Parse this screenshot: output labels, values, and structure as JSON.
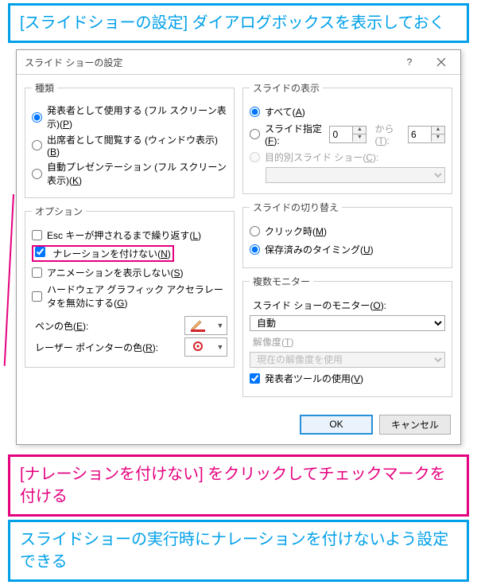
{
  "callouts": {
    "top": "[スライドショーの設定] ダイアログボックスを表示しておく",
    "click": "[ナレーションを付けない] をクリックしてチェックマークを付ける",
    "bottom": "スライドショーの実行時にナレーションを付けないよう設定できる"
  },
  "dialog": {
    "title": "スライド ショーの設定",
    "kind": {
      "legend": "種類",
      "presenter_pre": "発表者として使用する (フル スクリーン表示)(",
      "presenter_key": "P",
      "browse_pre": "出席者として閲覧する (ウィンドウ表示)(",
      "browse_key": "B",
      "kiosk_pre": "自動プレゼンテーション (フル スクリーン表示)(",
      "kiosk_key": "K",
      "close_paren": ")"
    },
    "options": {
      "legend": "オプション",
      "loop_pre": "Esc キーが押されるまで繰り返す(",
      "loop_key": "L",
      "no_narr_pre": "ナレーションを付けない(",
      "no_narr_key": "N",
      "no_anim_pre": "アニメーションを表示しない(",
      "no_anim_key": "S",
      "hw_pre": "ハードウェア グラフィック アクセラレータを無効にする(",
      "hw_key": "G",
      "close_paren": ")",
      "pen_label_pre": "ペンの色(",
      "pen_label_key": "E",
      "pen_label_post": "):",
      "laser_label_pre": "レーザー ポインターの色(",
      "laser_label_key": "R",
      "laser_label_post": "):"
    },
    "show": {
      "legend": "スライドの表示",
      "all_pre": "すべて(",
      "all_key": "A",
      "all_post": ")",
      "range_pre": "スライド指定(",
      "range_key": "F",
      "range_post": "):",
      "from_val": "0",
      "to_label_pre": "から(",
      "to_label_key": "T",
      "to_label_post": "):",
      "to_val": "6",
      "custom_pre": "目的別スライド ショー(",
      "custom_key": "C",
      "custom_post": "):"
    },
    "advance": {
      "legend": "スライドの切り替え",
      "manual_pre": "クリック時(",
      "manual_key": "M",
      "manual_post": ")",
      "timing_pre": "保存済みのタイミング(",
      "timing_key": "U",
      "timing_post": ")"
    },
    "monitors": {
      "legend": "複数モニター",
      "monitor_label_pre": "スライド ショーのモニター(",
      "monitor_label_key": "O",
      "monitor_label_post": "):",
      "monitor_value": "自動",
      "res_label_pre": "解像度(",
      "res_label_key": "T",
      "res_label_post": ")",
      "res_value": "現在の解像度を使用",
      "presenter_view_pre": "発表者ツールの使用(",
      "presenter_view_key": "V",
      "presenter_view_post": ")"
    },
    "footer": {
      "ok": "OK",
      "cancel": "キャンセル"
    }
  }
}
